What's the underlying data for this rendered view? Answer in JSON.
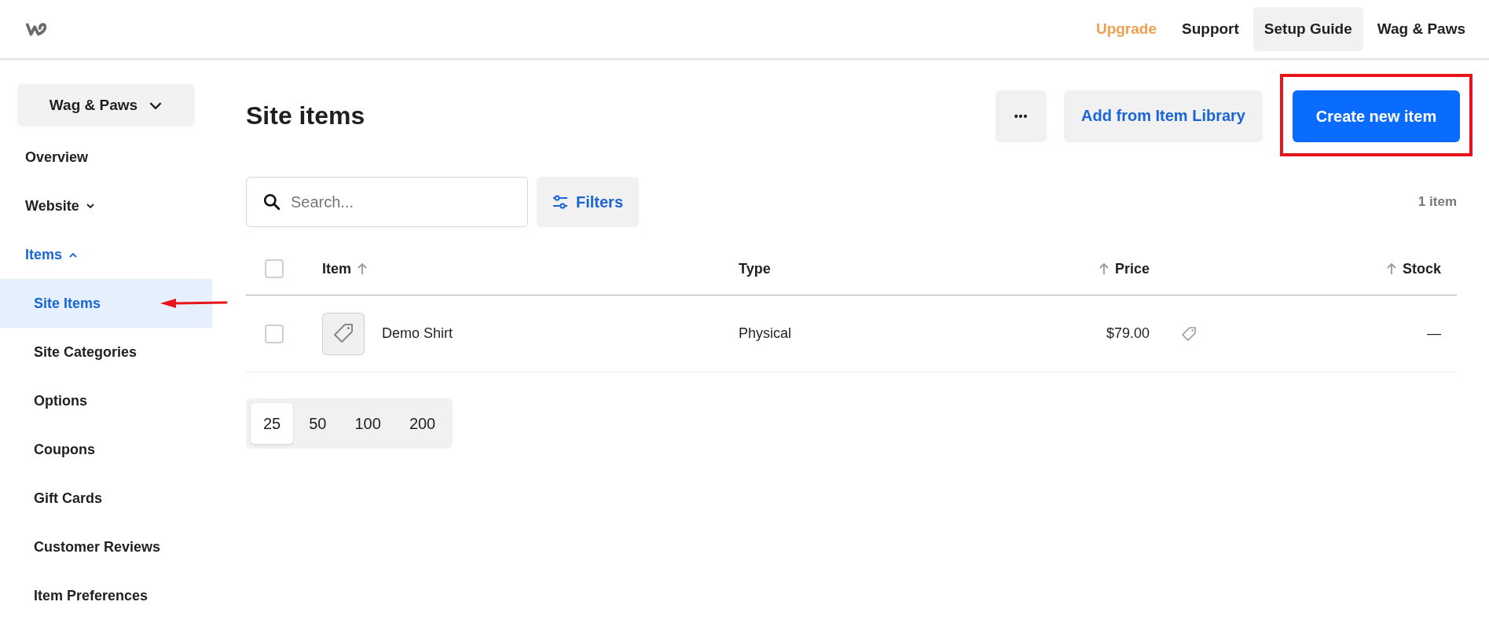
{
  "header": {
    "nav": [
      {
        "label": "Upgrade",
        "kind": "upgrade",
        "selected": false
      },
      {
        "label": "Support",
        "kind": "link",
        "selected": false
      },
      {
        "label": "Setup Guide",
        "kind": "link",
        "selected": true
      },
      {
        "label": "Wag & Paws",
        "kind": "link",
        "selected": false
      }
    ]
  },
  "sidebar": {
    "site_menu": "Wag & Paws",
    "items": [
      {
        "label": "Overview",
        "selected": false
      },
      {
        "label": "Website",
        "selected": false,
        "expanded": false
      },
      {
        "label": "Items",
        "selected": true,
        "expanded": true,
        "children": [
          {
            "label": "Site Items",
            "selected": true
          },
          {
            "label": "Site Categories",
            "selected": false
          },
          {
            "label": "Options",
            "selected": false
          },
          {
            "label": "Coupons",
            "selected": false
          },
          {
            "label": "Gift Cards",
            "selected": false
          },
          {
            "label": "Customer Reviews",
            "selected": false
          },
          {
            "label": "Item Preferences",
            "selected": false
          }
        ]
      }
    ]
  },
  "page": {
    "title": "Site items",
    "more_button": "•••",
    "library_button": "Add from Item Library",
    "create_button": "Create new item"
  },
  "search": {
    "placeholder": "Search..."
  },
  "filters_button": "Filters",
  "count": "1 item",
  "table": {
    "columns": [
      {
        "label": "Item",
        "kind": "trailing"
      },
      {
        "label": "Type",
        "kind": "plain"
      },
      {
        "label": "Price",
        "kind": "leading"
      },
      {
        "label": "Stock",
        "kind": "leading"
      }
    ],
    "header_checked": false,
    "rows": [
      {
        "checked": false,
        "item": "Demo Shirt",
        "type": "Physical",
        "price": "$79.00",
        "stock": "—"
      }
    ]
  },
  "page_sizes": [
    {
      "label": "25",
      "selected": true
    },
    {
      "label": "50",
      "selected": false
    },
    {
      "label": "100",
      "selected": false
    },
    {
      "label": "200",
      "selected": false
    }
  ]
}
